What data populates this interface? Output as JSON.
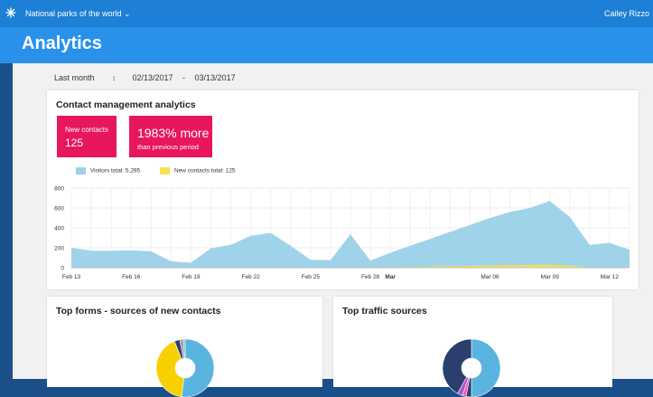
{
  "topbar": {
    "workspace": "National parks of the world ⌄",
    "user": "Cailey Rizzo"
  },
  "page": {
    "title": "Analytics"
  },
  "filters": {
    "range": "Last month",
    "start": "02/13/2017",
    "separator": "-",
    "end": "03/13/2017"
  },
  "contact_card": {
    "title": "Contact management analytics",
    "stat_new_label": "New contacts",
    "stat_new_value": "125",
    "stat_more_value": "1983% more",
    "stat_more_label": "than previous period",
    "legend_visitors": "Visitors total: 5,295",
    "legend_contacts": "New contacts total: 125",
    "colors": {
      "accent": "#e8165f",
      "visitors": "#9fd3ea",
      "contacts": "#f5e154"
    }
  },
  "forms_card": {
    "title": "Top forms - sources of new contacts"
  },
  "traffic_card": {
    "title": "Top traffic sources"
  },
  "chart_data": [
    {
      "type": "area",
      "title": "",
      "xlabel": "",
      "ylabel": "",
      "ylim": [
        0,
        800
      ],
      "yticks": [
        0,
        200,
        400,
        600,
        800
      ],
      "x_ticks": [
        {
          "label": "Feb 13",
          "i": 0
        },
        {
          "label": "Feb 16",
          "i": 3
        },
        {
          "label": "Feb 19",
          "i": 6
        },
        {
          "label": "Feb 22",
          "i": 9
        },
        {
          "label": "Feb 25",
          "i": 12
        },
        {
          "label": "Feb 28",
          "i": 15
        },
        {
          "label": "Mar",
          "i": 16,
          "bold": true
        },
        {
          "label": "Mar 06",
          "i": 21
        },
        {
          "label": "Mar 09",
          "i": 24
        },
        {
          "label": "Mar 12",
          "i": 27
        }
      ],
      "grid": true,
      "legend": "top-left",
      "series": [
        {
          "name": "Visitors total: 5,295",
          "color": "#9fd3ea",
          "values": [
            200,
            170,
            170,
            175,
            165,
            65,
            50,
            195,
            230,
            320,
            350,
            220,
            80,
            75,
            335,
            70,
            150,
            220,
            290,
            360,
            430,
            500,
            560,
            600,
            670,
            510,
            230,
            250,
            180
          ]
        },
        {
          "name": "New contacts total: 125",
          "color": "#f5e154",
          "values": [
            0,
            0,
            0,
            0,
            0,
            0,
            0,
            0,
            0,
            0,
            0,
            0,
            0,
            0,
            0,
            0,
            4,
            8,
            10,
            15,
            18,
            22,
            25,
            28,
            30,
            20,
            5,
            0,
            0
          ]
        }
      ]
    },
    {
      "type": "pie",
      "title": "",
      "slices": [
        {
          "value": 52,
          "color": "#59b4e0"
        },
        {
          "value": 42,
          "color": "#f8d000"
        },
        {
          "value": 3,
          "color": "#2a3f6e"
        },
        {
          "value": 2,
          "color": "#9e9e9e"
        },
        {
          "value": 1,
          "color": "#59b4e0"
        }
      ]
    },
    {
      "type": "pie",
      "title": "",
      "slices": [
        {
          "value": 50,
          "color": "#59b4e0"
        },
        {
          "value": 3,
          "color": "#2a3f6e"
        },
        {
          "value": 2,
          "color": "#ff4fb3"
        },
        {
          "value": 3,
          "color": "#a45bd1"
        },
        {
          "value": 42,
          "color": "#2a3f6e"
        }
      ]
    }
  ]
}
